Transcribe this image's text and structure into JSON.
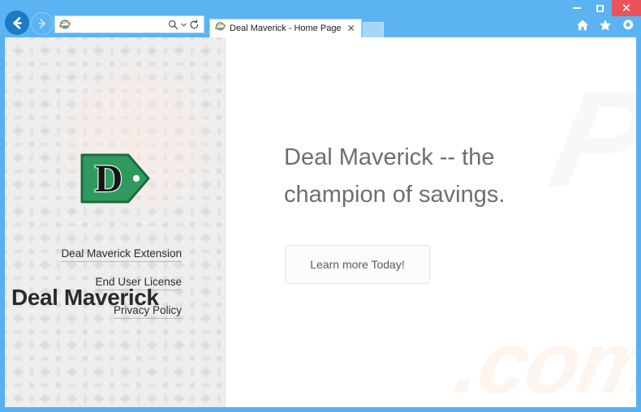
{
  "window": {
    "controls": {
      "minimize_label": "–",
      "maximize_label": "□",
      "close_label": "✕"
    }
  },
  "toolbar": {
    "back_label": "←",
    "forward_label": "→",
    "address_value": "",
    "address_placeholder": "",
    "search_icon": "search-icon",
    "caret_icon": "chevron-down-icon",
    "refresh_icon": "refresh-icon",
    "ie_icon": "internet-explorer-icon",
    "home_icon": "home-icon",
    "favorites_icon": "star-icon",
    "settings_icon": "gear-icon"
  },
  "tabs": [
    {
      "title": "Deal Maverick - Home Page",
      "favicon": "internet-explorer-icon",
      "close_label": "✕",
      "active": true
    }
  ],
  "new_tab_label": "",
  "sidebar": {
    "logo": {
      "letter": "D",
      "name": "deal-maverick-tag-logo",
      "tag_color": "#2f9a5e",
      "tag_border_color": "#1c6b3f",
      "letter_color": "#141414"
    },
    "links": [
      {
        "label": "Deal Maverick Extension"
      },
      {
        "label": "End User License"
      },
      {
        "label": "Privacy Policy"
      }
    ]
  },
  "main": {
    "headline_line1": "Deal Maverick -- the",
    "headline_line2": "champion of savings.",
    "cta_label": "Learn more Today!"
  },
  "watermarks": {
    "top": "PC",
    "bottom": ".com",
    "sidebar": "Deal Maverick"
  },
  "colors": {
    "chrome_blue": "#5cb3f2",
    "close_red": "#e8545a",
    "sidebar_bg": "#eeeeee",
    "headline_gray": "#6e6e6e",
    "brand_green": "#2f9a5e"
  }
}
